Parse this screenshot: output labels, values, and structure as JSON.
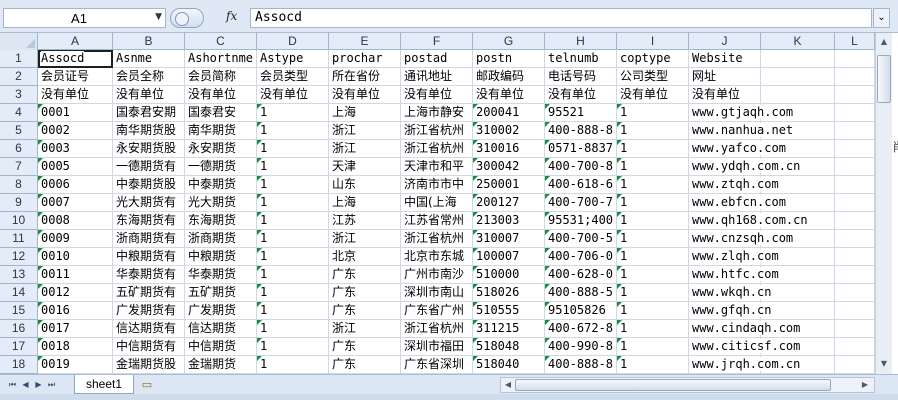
{
  "formula_bar": {
    "name_box": "A1",
    "name_box_arrow": "▼",
    "fx": "fx",
    "content": "Assocd",
    "expand_icon": "chevron-down-icon",
    "expand_glyph": "⌄"
  },
  "columns": [
    "A",
    "B",
    "C",
    "D",
    "E",
    "F",
    "G",
    "H",
    "I",
    "J",
    "K",
    "L"
  ],
  "rows": [
    {
      "num": "1",
      "cells": [
        "Assocd",
        "Asnme",
        "Ashortnme",
        "Astype",
        "prochar",
        "postad",
        "postn",
        "telnumb",
        "coptype",
        "Website",
        "",
        ""
      ]
    },
    {
      "num": "2",
      "cells": [
        "会员证号",
        "会员全称",
        "会员简称",
        "会员类型",
        "所在省份",
        "通讯地址",
        "邮政编码",
        "电话号码",
        "公司类型",
        "网址",
        "",
        ""
      ]
    },
    {
      "num": "3",
      "cells": [
        "没有单位",
        "没有单位",
        "没有单位",
        "没有单位",
        "没有单位",
        "没有单位",
        "没有单位",
        "没有单位",
        "没有单位",
        "没有单位",
        "",
        ""
      ]
    },
    {
      "num": "4",
      "cells": [
        "0001",
        "国泰君安期",
        "国泰君安",
        "1",
        "上海",
        "上海市静安",
        "200041",
        "95521",
        "1",
        "www.gtjaqh.com",
        "",
        ""
      ]
    },
    {
      "num": "5",
      "cells": [
        "0002",
        "南华期货股",
        "南华期货",
        "1",
        "浙江",
        "浙江省杭州",
        "310002",
        "400-888-8",
        "1",
        "www.nanhua.net",
        "",
        ""
      ]
    },
    {
      "num": "6",
      "cells": [
        "0003",
        "永安期货股",
        "永安期货",
        "1",
        "浙江",
        "浙江省杭州",
        "310016",
        "0571-8837",
        "1",
        "www.yafco.com",
        "",
        ""
      ]
    },
    {
      "num": "7",
      "cells": [
        "0005",
        "一德期货有",
        "一德期货",
        "1",
        "天津",
        "天津市和平",
        "300042",
        "400-700-8",
        "1",
        "www.ydqh.com.cn",
        "",
        ""
      ]
    },
    {
      "num": "8",
      "cells": [
        "0006",
        "中泰期货股",
        "中泰期货",
        "1",
        "山东",
        "济南市市中",
        "250001",
        "400-618-6",
        "1",
        "www.ztqh.com",
        "",
        ""
      ]
    },
    {
      "num": "9",
      "cells": [
        "0007",
        "光大期货有",
        "光大期货",
        "1",
        "上海",
        "中国(上海",
        "200127",
        "400-700-7",
        "1",
        "www.ebfcn.com",
        "",
        ""
      ]
    },
    {
      "num": "10",
      "cells": [
        "0008",
        "东海期货有",
        "东海期货",
        "1",
        "江苏",
        "江苏省常州",
        "213003",
        "95531;400",
        "1",
        "www.qh168.com.cn",
        "",
        ""
      ]
    },
    {
      "num": "11",
      "cells": [
        "0009",
        "浙商期货有",
        "浙商期货",
        "1",
        "浙江",
        "浙江省杭州",
        "310007",
        "400-700-5",
        "1",
        "www.cnzsqh.com",
        "",
        ""
      ]
    },
    {
      "num": "12",
      "cells": [
        "0010",
        "中粮期货有",
        "中粮期货",
        "1",
        "北京",
        "北京市东城",
        "100007",
        "400-706-0",
        "1",
        "www.zlqh.com",
        "",
        ""
      ]
    },
    {
      "num": "13",
      "cells": [
        "0011",
        "华泰期货有",
        "华泰期货",
        "1",
        "广东",
        "广州市南沙",
        "510000",
        "400-628-0",
        "1",
        "www.htfc.com",
        "",
        ""
      ]
    },
    {
      "num": "14",
      "cells": [
        "0012",
        "五矿期货有",
        "五矿期货",
        "1",
        "广东",
        "深圳市南山",
        "518026",
        "400-888-5",
        "1",
        "www.wkqh.cn",
        "",
        ""
      ]
    },
    {
      "num": "15",
      "cells": [
        "0016",
        "广发期货有",
        "广发期货",
        "1",
        "广东",
        "广东省广州",
        "510555",
        "95105826",
        "1",
        "www.gfqh.cn",
        "",
        ""
      ]
    },
    {
      "num": "16",
      "cells": [
        "0017",
        "信达期货有",
        "信达期货",
        "1",
        "浙江",
        "浙江省杭州",
        "311215",
        "400-672-8",
        "1",
        "www.cindaqh.com",
        "",
        ""
      ]
    },
    {
      "num": "17",
      "cells": [
        "0018",
        "中信期货有",
        "中信期货",
        "1",
        "广东",
        "深圳市福田",
        "518048",
        "400-990-8",
        "1",
        "www.citicsf.com",
        "",
        ""
      ]
    },
    {
      "num": "18",
      "cells": [
        "0019",
        "金瑞期货股",
        "金瑞期货",
        "1",
        "广东",
        "广东省深圳",
        "518040",
        "400-888-8",
        "1",
        "www.jrqh.com.cn",
        "",
        ""
      ]
    }
  ],
  "sheet_tabs": {
    "nav": {
      "first": "⏮",
      "prev": "◀",
      "next": "▶",
      "last": "⏭"
    },
    "active": "sheet1",
    "insert_icon": "insert-sheet-icon",
    "insert_glyph": "▭"
  },
  "scrollbars": {
    "up": "▲",
    "down": "▼",
    "left": "◀",
    "right": "▶"
  },
  "side_glyph": "肖"
}
